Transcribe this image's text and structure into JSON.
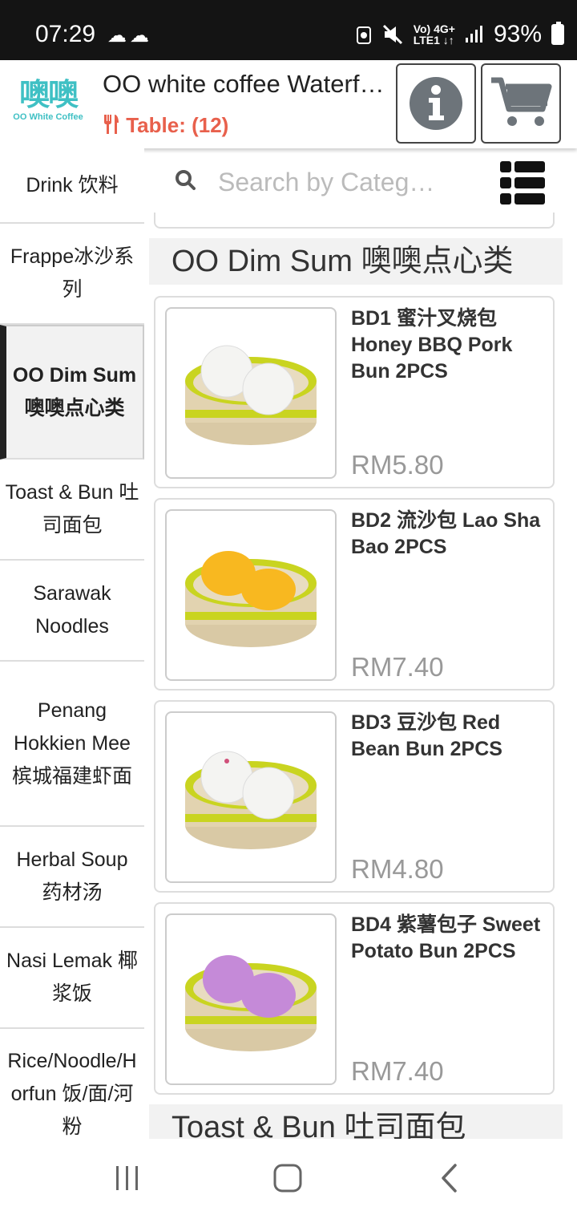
{
  "status_bar": {
    "time": "07:29",
    "left_icons": "☁☁",
    "net_top": "Vo) 4G+",
    "net_bottom": "LTE1 ↓↑",
    "battery": "93%"
  },
  "header": {
    "logo_glyph": "噢噢",
    "logo_subtitle": "OO White Coffee",
    "store_title": "OO white coffee Waterfront",
    "table_label": "Table: (12)",
    "accent_color": "#e8604c"
  },
  "sidebar": {
    "items": [
      {
        "label": "Drink 饮料"
      },
      {
        "label": "Frappe冰沙系列"
      },
      {
        "label": "OO Dim Sum 噢噢点心类"
      },
      {
        "label": "Toast & Bun 吐司面包"
      },
      {
        "label": "Sarawak Noodles"
      },
      {
        "label": "Penang Hokkien Mee 槟城福建虾面"
      },
      {
        "label": "Herbal Soup 药材汤"
      },
      {
        "label": "Nasi Lemak 椰浆饭"
      },
      {
        "label": "Rice/Noodle/Horfun 饭/面/河粉"
      }
    ],
    "active_index": 2
  },
  "search": {
    "placeholder": "Search by Category"
  },
  "section": {
    "title": "OO Dim Sum 噢噢点心类"
  },
  "products": [
    {
      "name": "BD1 蜜汁叉烧包 Honey BBQ Pork Bun 2PCS",
      "price": "RM5.80",
      "bun_color": "#f4f4f2"
    },
    {
      "name": "BD2 流沙包 Lao Sha Bao 2PCS",
      "price": "RM7.40",
      "bun_color": "#f8b820"
    },
    {
      "name": "BD3 豆沙包 Red Bean Bun 2PCS",
      "price": "RM4.80",
      "bun_color": "#f4f4f2"
    },
    {
      "name": "BD4 紫薯包子 Sweet Potato Bun 2PCS",
      "price": "RM7.40",
      "bun_color": "#c58ad8"
    }
  ],
  "next_section": {
    "title": "Toast & Bun 吐司面包"
  }
}
